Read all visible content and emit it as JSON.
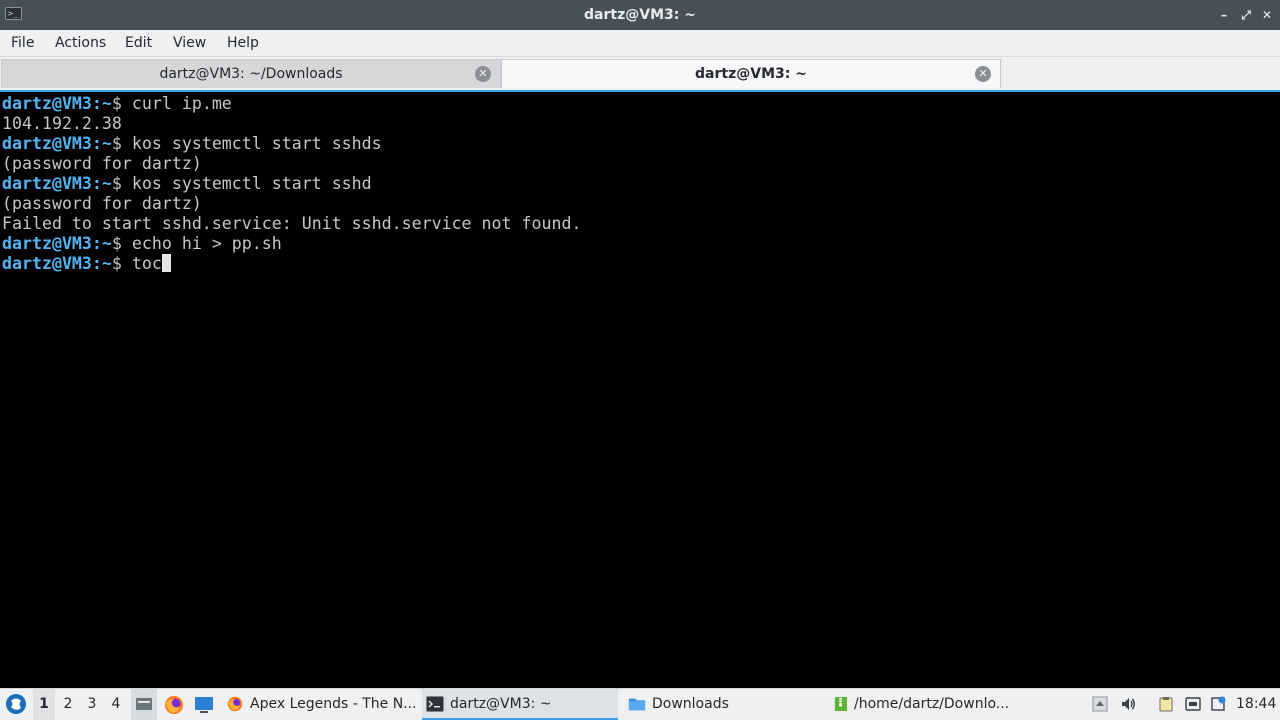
{
  "window": {
    "title": "dartz@VM3: ~",
    "app_icon_glyph": ">_",
    "minimize_glyph": "–",
    "maximize_glyph": "⤢",
    "close_glyph": "✕"
  },
  "menu": {
    "file": "File",
    "actions": "Actions",
    "edit": "Edit",
    "view": "View",
    "help": "Help"
  },
  "tabs": [
    {
      "label": "dartz@VM3: ~/Downloads",
      "active": false
    },
    {
      "label": "dartz@VM3: ~",
      "active": true
    }
  ],
  "terminal": {
    "prompt_user_host": "dartz@VM3",
    "prompt_path": ":~",
    "prompt_symbol": "$ ",
    "lines": [
      {
        "type": "cmd",
        "text": "curl ip.me"
      },
      {
        "type": "out",
        "text": "104.192.2.38"
      },
      {
        "type": "cmd",
        "text": "kos systemctl start sshds"
      },
      {
        "type": "out",
        "text": "(password for dartz)"
      },
      {
        "type": "cmd",
        "text": "kos systemctl start sshd"
      },
      {
        "type": "out",
        "text": "(password for dartz)"
      },
      {
        "type": "out",
        "text": "Failed to start sshd.service: Unit sshd.service not found."
      },
      {
        "type": "cmd",
        "text": "echo hi > pp.sh"
      },
      {
        "type": "cmd",
        "text": "toc",
        "cursor": true
      }
    ],
    "colors": {
      "background": "#000000",
      "prompt": "#54b4f4",
      "text": "#c5c8c6"
    }
  },
  "taskbar": {
    "workspaces": [
      "1",
      "2",
      "3",
      "4"
    ],
    "current_workspace": "1",
    "tasks": [
      {
        "label": "Apex Legends - The N...",
        "icon": "firefox-icon"
      },
      {
        "label": "dartz@VM3: ~",
        "icon": "terminal-icon",
        "active": true
      },
      {
        "label": "Downloads",
        "icon": "folder-icon"
      },
      {
        "label": "/home/dartz/Downlo...",
        "icon": "archive-icon"
      }
    ],
    "clock": "18:44"
  }
}
